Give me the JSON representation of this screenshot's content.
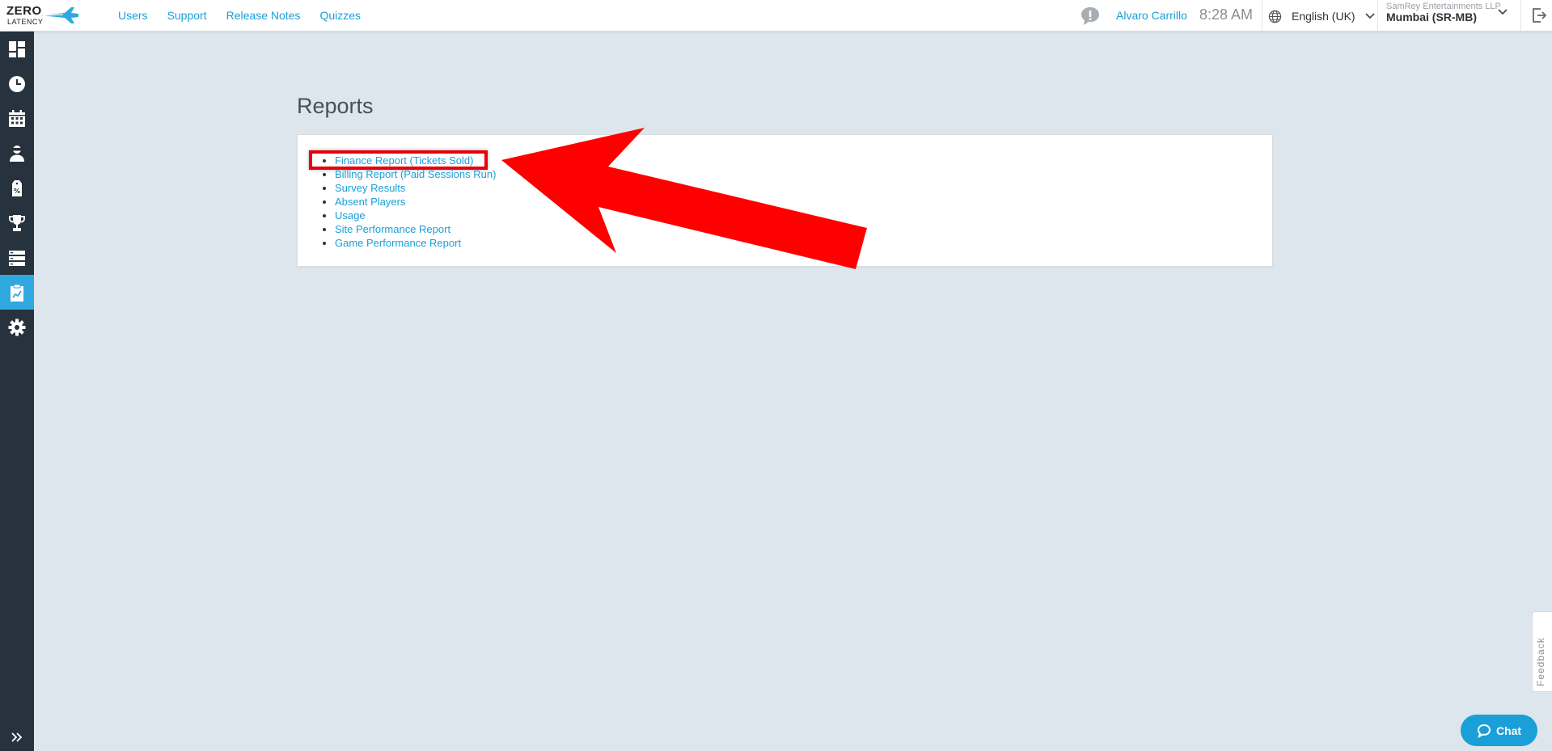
{
  "brand": {
    "line1": "ZERO",
    "line2": "LATENCY"
  },
  "nav": [
    {
      "label": "Users"
    },
    {
      "label": "Support"
    },
    {
      "label": "Release Notes"
    },
    {
      "label": "Quizzes"
    }
  ],
  "header": {
    "user_name": "Alvaro Carrillo",
    "time": "8:28 AM",
    "language": "English (UK)",
    "company": "SamRey Entertainments LLP",
    "site": "Mumbai (SR-MB)"
  },
  "sidebar": {
    "items": [
      {
        "icon": "dashboard-icon"
      },
      {
        "icon": "clock-icon"
      },
      {
        "icon": "calendar-icon"
      },
      {
        "icon": "player-icon"
      },
      {
        "icon": "discount-tag-icon"
      },
      {
        "icon": "trophy-icon"
      },
      {
        "icon": "server-icon"
      },
      {
        "icon": "reports-clipboard-icon",
        "active": true
      },
      {
        "icon": "gear-icon"
      }
    ],
    "expand_icon": "double-chevron-right-icon"
  },
  "main": {
    "title": "Reports",
    "reports": [
      {
        "label": "Finance Report (Tickets Sold)"
      },
      {
        "label": "Billing Report (Paid Sessions Run)"
      },
      {
        "label": "Survey Results"
      },
      {
        "label": "Absent Players"
      },
      {
        "label": "Usage"
      },
      {
        "label": "Site Performance Report"
      },
      {
        "label": "Game Performance Report"
      }
    ]
  },
  "feedback_label": "Feedback",
  "chat_label": "Chat",
  "colors": {
    "accent": "#1a9fd8",
    "sidebar": "#26323d",
    "annotation": "#e8000b",
    "background": "#dde6ed"
  }
}
